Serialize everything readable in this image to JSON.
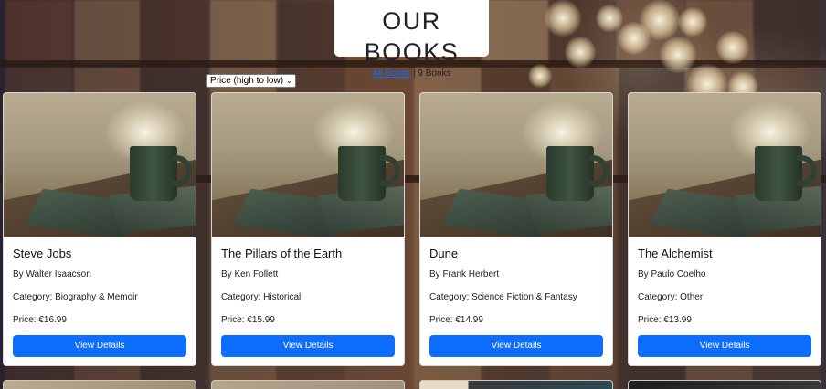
{
  "header": {
    "title": "OUR BOOKS",
    "all_books_link": "All Books",
    "separator": "|",
    "count_text": "9 Books"
  },
  "sort": {
    "selected": "Price (high to low)"
  },
  "card_button_label": "View Details",
  "colors": {
    "accent": "#0d6efd",
    "card_background": "#ffffff"
  },
  "books": [
    {
      "title": "Steve Jobs",
      "author": "By Walter Isaacson",
      "category": "Category: Biography & Memoir",
      "price": "Price: €16.99"
    },
    {
      "title": "The Pillars of the Earth",
      "author": "By Ken Follett",
      "category": "Category: Historical",
      "price": "Price: €15.99"
    },
    {
      "title": "Dune",
      "author": "By Frank Herbert",
      "category": "Category: Science Fiction & Fantasy",
      "price": "Price: €14.99"
    },
    {
      "title": "The Alchemist",
      "author": "By Paulo Coelho",
      "category": "Category: Other",
      "price": "Price: €13.99"
    }
  ]
}
